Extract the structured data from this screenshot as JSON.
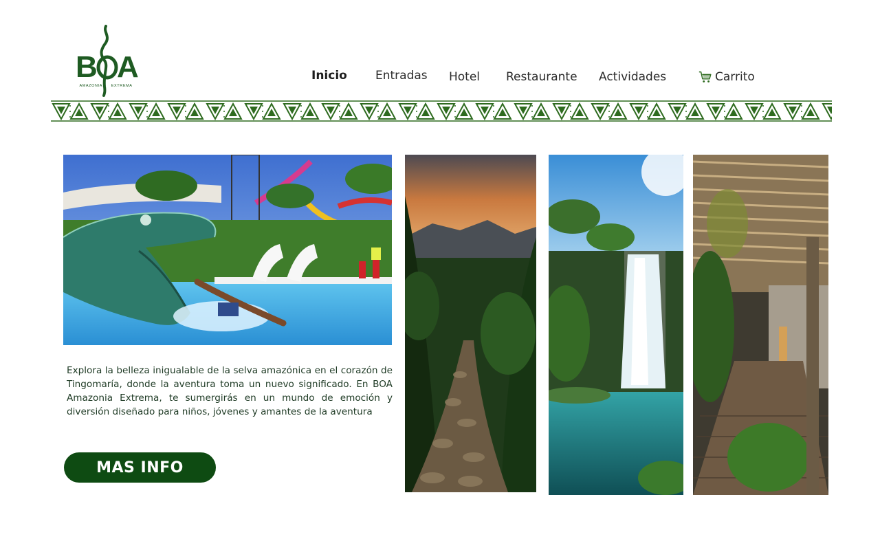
{
  "brand": {
    "logo_text": "BOA",
    "logo_sub_left": "AMAZONIA",
    "logo_sub_right": "EXTREMA",
    "accent_color": "#0e4b12",
    "pattern_color": "#2e6b1f"
  },
  "nav": {
    "items": [
      {
        "label": "Inicio",
        "active": true
      },
      {
        "label": "Entradas",
        "active": false
      },
      {
        "label": "Hotel",
        "active": false
      },
      {
        "label": "Restaurante",
        "active": false
      },
      {
        "label": "Actividades",
        "active": false
      }
    ],
    "cart_label": "Carrito",
    "cart_icon": "cart-icon"
  },
  "hero": {
    "description": "Explora la belleza inigualable de la selva amazónica en el corazón de Tingomaría, donde la aventura toma un nuevo significado. En BOA Amazonia Extrema, te sumergirás en un mundo de emoción y diversión diseñado para niños, jóvenes y amantes de la aventura",
    "cta_label": "MAS INFO"
  },
  "gallery": [
    {
      "name": "waterpark-snake-slide-photo"
    },
    {
      "name": "jungle-stone-path-photo"
    },
    {
      "name": "waterfall-lagoon-photo"
    },
    {
      "name": "wooden-walkway-photo"
    }
  ]
}
